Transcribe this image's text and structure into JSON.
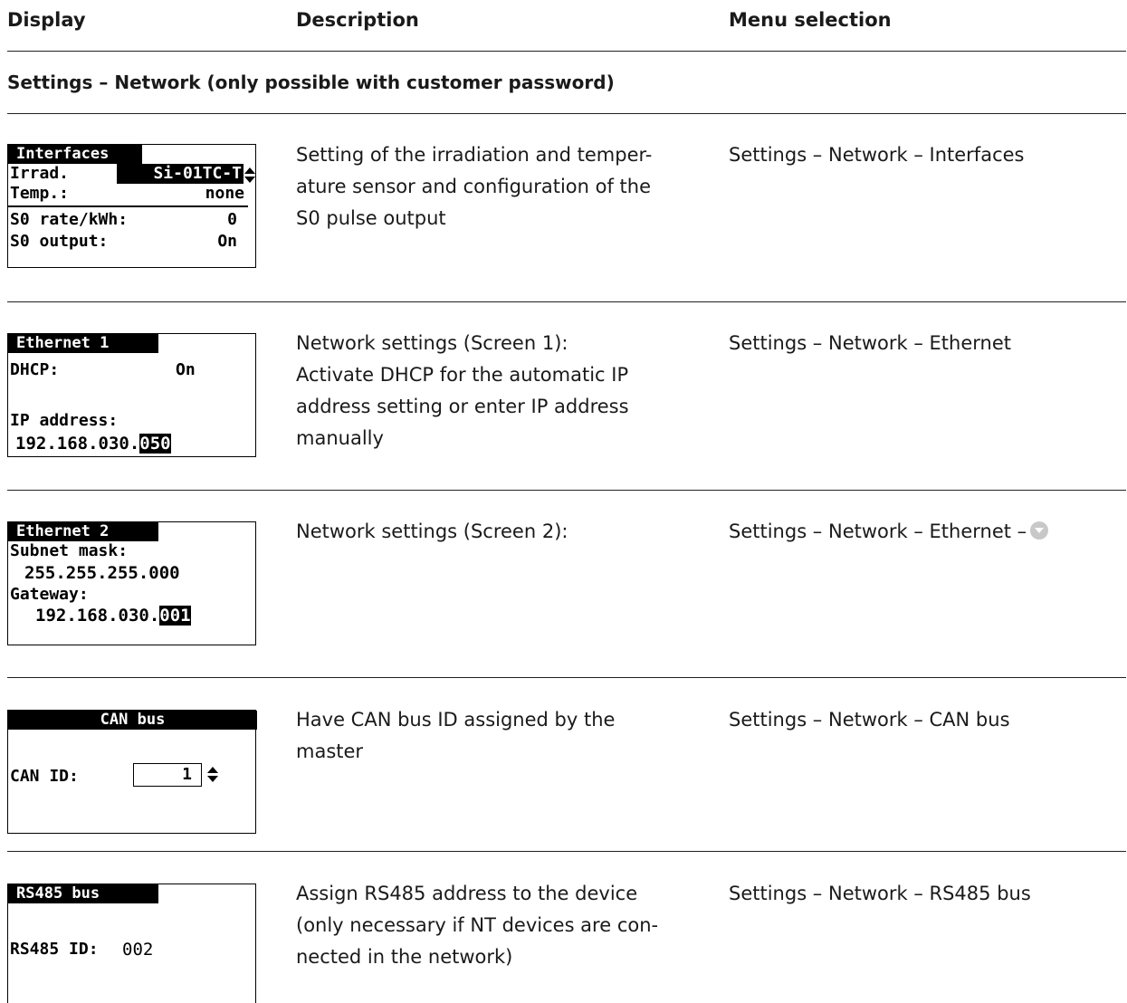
{
  "header": {
    "display": "Display",
    "description": "Description",
    "menu": "Menu selection"
  },
  "section_title": "Settings – Network (only possible with customer password)",
  "icons": {
    "menu_down_icon": "circle-down-arrow"
  },
  "rows": [
    {
      "lcd": {
        "title": "Interfaces",
        "irrad_label": "Irrad.",
        "irrad_value": "Si-01TC-T",
        "temp_label": "Temp.:",
        "temp_value": "none",
        "s0rate_label": "S0 rate/kWh:",
        "s0rate_value": "0",
        "s0out_label": "S0 output:",
        "s0out_value": "On"
      },
      "desc_lines": [
        "Setting of the irradiation and temper-",
        "ature sensor and configuration of the",
        "S0 pulse output"
      ],
      "menu": "Settings – Network – Interfaces"
    },
    {
      "lcd": {
        "title": "Ethernet 1",
        "dhcp_label": "DHCP:",
        "dhcp_value": "On",
        "ip_label": "IP address:",
        "ip_prefix": "192.168.030.",
        "ip_last": "050"
      },
      "desc_lines": [
        "Network settings (Screen 1):",
        "Activate DHCP for the automatic IP",
        "address setting or enter IP address",
        "manually"
      ],
      "menu": "Settings – Network – Ethernet"
    },
    {
      "lcd": {
        "title": "Ethernet 2",
        "subnet_label": "Subnet mask:",
        "subnet_value": "255.255.255.000",
        "gateway_label": "Gateway:",
        "gw_prefix": "192.168.030.",
        "gw_last": "001"
      },
      "desc_lines": [
        "Network settings (Screen 2):"
      ],
      "menu": "Settings – Network – Ethernet –"
    },
    {
      "lcd": {
        "title": "CAN bus",
        "id_label": "CAN ID:",
        "id_value": "1"
      },
      "desc_lines": [
        "Have CAN bus ID assigned by the",
        "master"
      ],
      "menu": "Settings – Network – CAN bus"
    },
    {
      "lcd": {
        "title": "RS485 bus",
        "id_label": "RS485 ID:",
        "id_value": "002"
      },
      "desc_lines": [
        "Assign RS485 address to the device",
        "(only necessary if NT devices are con-",
        "nected in the network)"
      ],
      "menu": "Settings – Network – RS485 bus"
    }
  ]
}
